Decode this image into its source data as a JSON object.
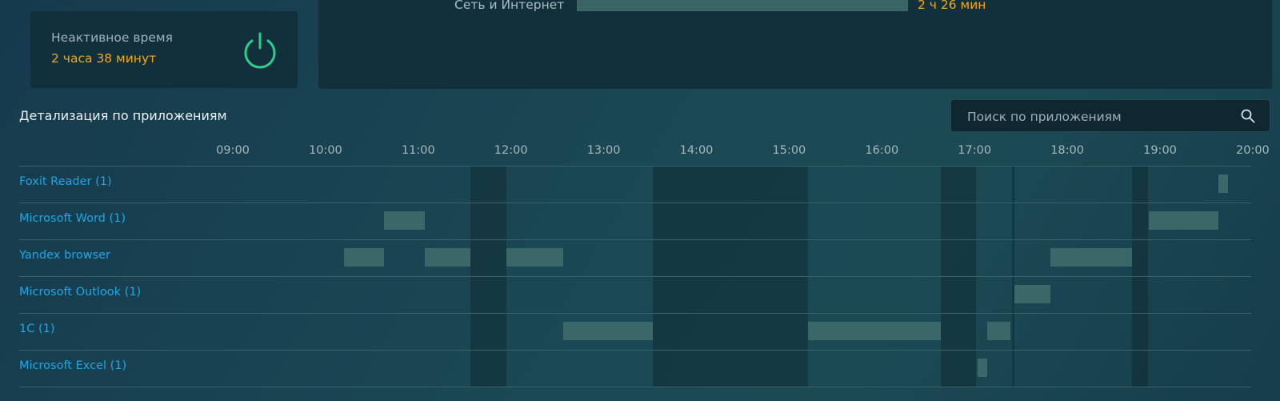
{
  "inactive": {
    "label": "Неактивное время",
    "value": "2 часа 38 минут",
    "icon": "power-icon",
    "icon_color": "#2ecc8a"
  },
  "category": {
    "label": "Сеть и Интернет",
    "value": "2 ч 26 мин"
  },
  "details": {
    "title": "Детализация по приложениям",
    "search_placeholder": "Поиск по приложениям",
    "search_icon": "search-icon"
  },
  "timeline": {
    "ticks": [
      "09:00",
      "10:00",
      "11:00",
      "12:00",
      "13:00",
      "14:00",
      "15:00",
      "16:00",
      "17:00",
      "18:00",
      "19:00",
      "20:00"
    ],
    "rows": [
      {
        "label": "Foxit Reader (1)",
        "segments": [
          [
            "19:38",
            "19:44"
          ]
        ]
      },
      {
        "label": "Microsoft Word (1)",
        "segments": [
          [
            "10:38",
            "11:04"
          ],
          [
            "18:53",
            "19:38"
          ]
        ]
      },
      {
        "label": "Yandex browser",
        "segments": [
          [
            "10:12",
            "10:38"
          ],
          [
            "11:04",
            "11:34"
          ],
          [
            "11:57",
            "12:34"
          ],
          [
            "17:49",
            "18:42"
          ]
        ]
      },
      {
        "label": "Microsoft Outlook (1)",
        "segments": [
          [
            "17:26",
            "17:49"
          ]
        ]
      },
      {
        "label": "1С (1)",
        "segments": [
          [
            "12:34",
            "13:32"
          ],
          [
            "15:12",
            "16:38"
          ],
          [
            "17:08",
            "17:23"
          ]
        ]
      },
      {
        "label": "Microsoft Excel (1)",
        "segments": [
          [
            "17:02",
            "17:08"
          ]
        ]
      }
    ],
    "idle_periods": [
      [
        "11:34",
        "11:57"
      ],
      [
        "13:32",
        "15:12"
      ],
      [
        "16:38",
        "17:01"
      ],
      [
        "17:24",
        "17:26"
      ],
      [
        "18:42",
        "18:52"
      ]
    ]
  }
}
